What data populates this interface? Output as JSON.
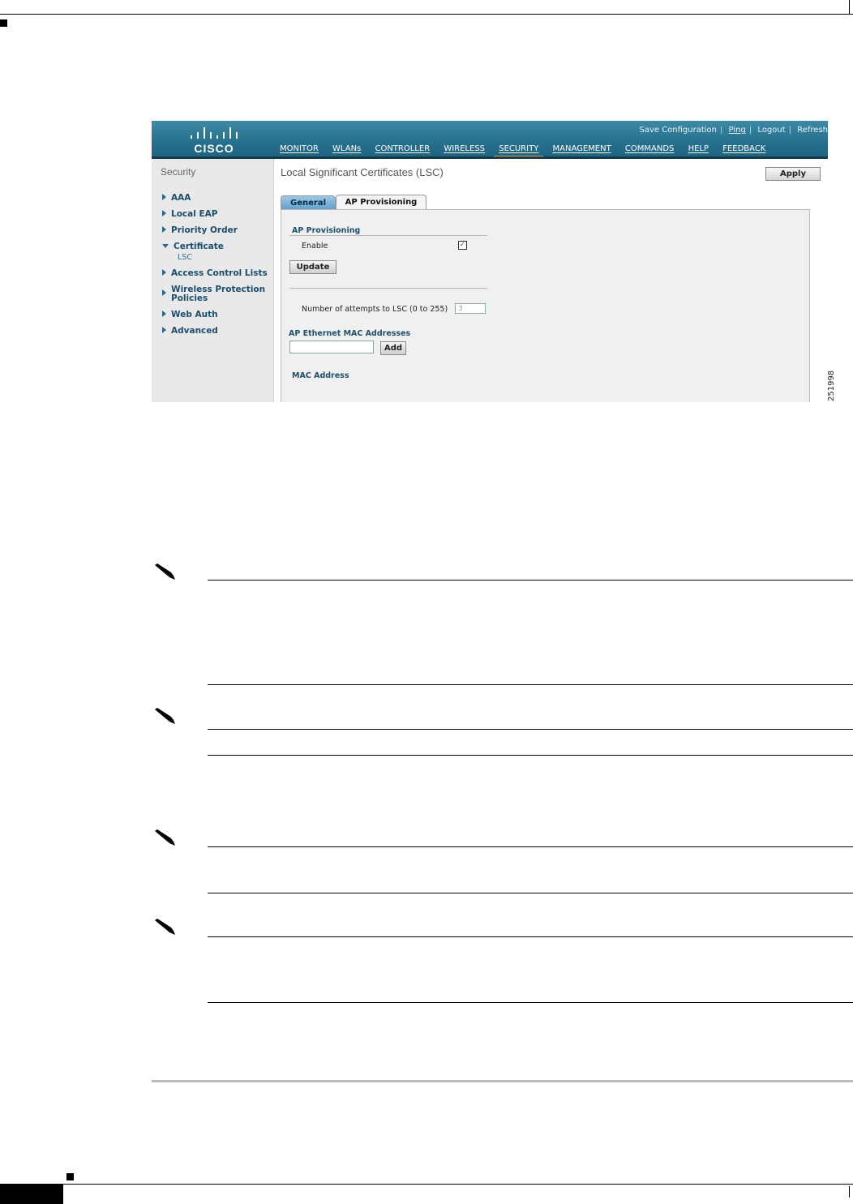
{
  "screenshot": {
    "utility_links": [
      "Save Configuration",
      "Ping",
      "Logout",
      "Refresh"
    ],
    "logo_text": "CISCO",
    "menu": [
      "MONITOR",
      "WLANs",
      "CONTROLLER",
      "WIRELESS",
      "SECURITY",
      "MANAGEMENT",
      "COMMANDS",
      "HELP",
      "FEEDBACK"
    ],
    "active_menu": "SECURITY",
    "sidebar": {
      "title": "Security",
      "items": [
        {
          "label": "AAA"
        },
        {
          "label": "Local EAP"
        },
        {
          "label": "Priority Order"
        },
        {
          "label": "Certificate"
        },
        {
          "label": "Access Control Lists"
        },
        {
          "label": "Wireless Protection"
        },
        {
          "label": "Policies"
        },
        {
          "label": "Web Auth"
        },
        {
          "label": "Advanced"
        }
      ],
      "sub_item": "LSC"
    },
    "page_title": "Local Significant Certificates (LSC)",
    "apply_label": "Apply",
    "tabs": [
      "General",
      "AP Provisioning"
    ],
    "active_tab": "AP Provisioning",
    "ap_provisioning": {
      "section_title": "AP Provisioning",
      "enable_label": "Enable",
      "enable_checked": true,
      "update_label": "Update",
      "attempts_label": "Number of attempts to LSC (0 to 255)",
      "attempts_value": "3",
      "mac_section_title": "AP Ethernet MAC Addresses",
      "mac_input_value": "",
      "add_label": "Add",
      "mac_column_header": "MAC Address"
    },
    "figure_id": "251998"
  },
  "icons": {
    "note": "pencil-note-icon",
    "checkmark": "check-icon"
  }
}
